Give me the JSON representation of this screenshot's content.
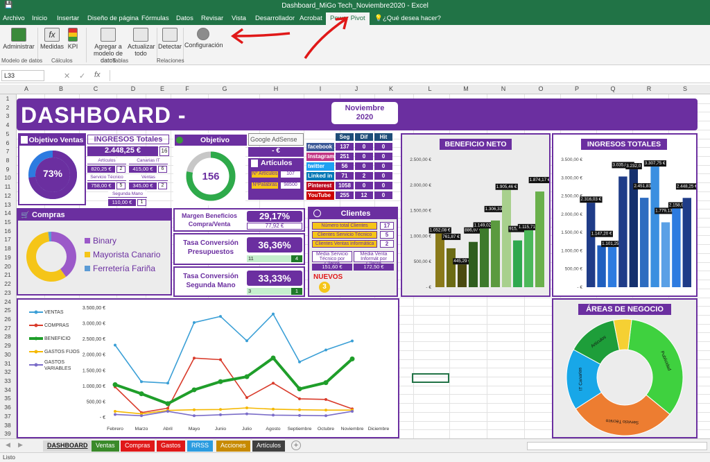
{
  "window": {
    "title": "Dashboard_MiGo Tech_Noviembre2020 - Excel"
  },
  "ribbon_tabs": [
    "Archivo",
    "Inicio",
    "Insertar",
    "Diseño de página",
    "Fórmulas",
    "Datos",
    "Revisar",
    "Vista",
    "Desarrollador",
    "Acrobat",
    "Power Pivot"
  ],
  "tellme": "¿Qué desea hacer?",
  "ribbon": {
    "buttons": [
      {
        "label": "Administrar"
      },
      {
        "label": "Medidas"
      },
      {
        "label": "KPI"
      },
      {
        "label": "Agregar a modelo de datos"
      },
      {
        "label": "Actualizar todo"
      },
      {
        "label": "Detectar"
      },
      {
        "label": "Configuración"
      }
    ],
    "groups": [
      "Modelo de datos",
      "Cálculos",
      "Tablas",
      "Relaciones"
    ]
  },
  "formula_bar": {
    "cell": "L33",
    "fx": "fx",
    "value": ""
  },
  "columns": [
    "A",
    "B",
    "C",
    "D",
    "E",
    "F",
    "G",
    "H",
    "I",
    "J",
    "K",
    "L",
    "M",
    "N",
    "O",
    "P",
    "Q",
    "R",
    "S"
  ],
  "rows": [
    "1",
    "2",
    "3",
    "4",
    "5",
    "6",
    "7",
    "8",
    "9",
    "10",
    "11",
    "12",
    "13",
    "14",
    "15",
    "16",
    "17",
    "18",
    "19",
    "20",
    "21",
    "22",
    "23",
    "24",
    "25",
    "26",
    "27",
    "28",
    "29",
    "30",
    "31",
    "32",
    "33",
    "34",
    "35",
    "36",
    "37",
    "38",
    "39"
  ],
  "dashboard": {
    "title": "DASHBOARD -",
    "period": "Noviembre 2020",
    "objetivo_ventas": {
      "title": "Objetivo Ventas",
      "pct": "73%",
      "pct_value": 0.73
    },
    "ingresos": {
      "title": "INGRESOS Totales",
      "total": "2.448,25 €",
      "count": "16",
      "items": [
        {
          "label": "Artículos",
          "value": "820,25 €",
          "n": "2"
        },
        {
          "label": "Canarias IT",
          "value": "415,00 €",
          "n": "6"
        },
        {
          "label": "Servicio Técnico",
          "value": "758,00 €",
          "n": "5"
        },
        {
          "label": "Ventas",
          "value": "345,00 €",
          "n": "2"
        },
        {
          "label": "Segunda Mano",
          "value": "110,00 €",
          "n": "1"
        }
      ]
    },
    "objetivo_beneficio": {
      "title": "Objetivo Beneficio",
      "value": "156",
      "fraction": 0.78
    },
    "adsense": {
      "label": "Google AdSense",
      "value": "-   €"
    },
    "articulos": {
      "title": "Artículos",
      "n_label": "Nº Artículos",
      "n_value": "107",
      "p_label": "NºPalabras",
      "p_value": "98500"
    },
    "social": {
      "headers": [
        "Seg",
        "Dif",
        "Hit"
      ],
      "rows": [
        {
          "net": "facebook",
          "color": "#3b5998",
          "v": [
            "137",
            "0",
            "0"
          ]
        },
        {
          "net": "Instagram",
          "color": "#c13584",
          "v": [
            "251",
            "0",
            "0"
          ]
        },
        {
          "net": "twitter",
          "color": "#1da1f2",
          "v": [
            "56",
            "0",
            "0"
          ]
        },
        {
          "net": "Linked in",
          "color": "#0077b5",
          "v": [
            "71",
            "2",
            "0"
          ]
        },
        {
          "net": "Pinterest",
          "color": "#bd081c",
          "v": [
            "1058",
            "0",
            "0"
          ]
        },
        {
          "net": "YouTube",
          "color": "#cc0000",
          "v": [
            "255",
            "12",
            "0"
          ]
        }
      ]
    },
    "compras": {
      "title": "Compras",
      "legend": [
        {
          "name": "Binary",
          "color": "#9b59c9"
        },
        {
          "name": "Mayorista Canario",
          "color": "#f5c518"
        },
        {
          "name": "Ferretería Fariña",
          "color": "#5b9bd5"
        }
      ],
      "fractions": [
        0.4,
        0.58,
        0.02
      ]
    },
    "margen": {
      "label": "Margen Beneficios Compra/Venta",
      "pct": "29,17%",
      "value": "77,92 €"
    },
    "conv_presup": {
      "label": "Tasa Conversión Presupuestos",
      "pct": "36,36%",
      "a": "11",
      "b": "4"
    },
    "conv_segunda": {
      "label": "Tasa Conversión Segunda Mano",
      "pct": "33,33%",
      "a": "3",
      "b": "1"
    },
    "clientes": {
      "title": "Clientes",
      "rows": [
        {
          "label": "Número total Clientes",
          "v": "17"
        },
        {
          "label": "Clientes Servicio Técnico",
          "v": "5"
        },
        {
          "label": "Clientes Ventas informática",
          "v": "2"
        }
      ],
      "media_st_label": "Media Servicio Técnico por Cliente",
      "media_st": "151,60 €",
      "media_vi_label": "Media Venta Informát por Cliente",
      "media_vi": "172,50 €",
      "nuevos_label": "NUEVOS",
      "nuevos": "3"
    }
  },
  "chart_data": [
    {
      "type": "bar",
      "title": "BENEFICIO NETO",
      "ylim": [
        0,
        2500
      ],
      "yticks": [
        "2.500,00 €",
        "2.000,00 €",
        "1.500,00 €",
        "1.000,00 €",
        "500,00 €",
        "-   €"
      ],
      "values": [
        1052.08,
        761.87,
        445.29,
        886.97,
        1149.02,
        1306.33,
        1905.46,
        915.75,
        1115.71,
        1874.17
      ],
      "labels": [
        "1.052,08 €",
        "761,87 €",
        "445,29 €",
        "886,97 €",
        "1.149,02 €",
        "1.306,33 €",
        "1.905,46 €",
        "915,75 €",
        "1.115,71 €",
        "1.874,17 €"
      ],
      "colors": [
        "#8a7a1a",
        "#6b6b14",
        "#4a4a10",
        "#2f5e1f",
        "#3d7a2b",
        "#5b9a3f",
        "#a8d08d",
        "#2fa84f",
        "#4cb85a",
        "#6ab04c"
      ]
    },
    {
      "type": "bar",
      "title": "INGRESOS TOTALES",
      "ylim": [
        0,
        3500
      ],
      "yticks": [
        "3.500,00 €",
        "3.000,00 €",
        "2.500,00 €",
        "2.000,00 €",
        "1.500,00 €",
        "1.000,00 €",
        "500,00 €",
        "-   €"
      ],
      "values": [
        2316.03,
        1147.2,
        1101.25,
        3035,
        3232,
        2451.83,
        3307.75,
        1779.13,
        2158.9,
        2448.25
      ],
      "labels": [
        "2.316,03 €",
        "1.147,20 €",
        "1.101,25 €",
        "3.035,00 €",
        "3.232,0",
        "2.451,83 €",
        "3.307,75 €",
        "1.779,13 €",
        "2.158,9",
        "2.448,25 €"
      ],
      "colors": [
        "#1f3c88",
        "#1f5fbf",
        "#2d7be0",
        "#1f3c88",
        "#15306e",
        "#2d6cc0",
        "#3b8fe0",
        "#5aa0e6",
        "#2d7be0",
        "#1f3c88"
      ]
    },
    {
      "type": "pie",
      "title": "ÁREAS DE NEGOCIO",
      "labels": [
        "Publicidad",
        "Servicio Técnico",
        "IT Canarias",
        "Artículos",
        ""
      ],
      "values": [
        34,
        30,
        17,
        14,
        5
      ],
      "colors": [
        "#3fd13f",
        "#ed7d31",
        "#18a7e8",
        "#1e9e3a",
        "#f5d033"
      ]
    },
    {
      "type": "line",
      "categories": [
        "Febrero",
        "Marzo",
        "Abril",
        "Mayo",
        "Junio",
        "Julio",
        "Agosto",
        "Septiembre",
        "Octubre",
        "Noviembre",
        "Diciembre"
      ],
      "yticks": [
        "3.500,00 €",
        "3.000,00 €",
        "2.500,00 €",
        "2.000,00 €",
        "1.500,00 €",
        "1.000,00 €",
        "500,00 €",
        "-   €"
      ],
      "ylim": [
        0,
        3500
      ],
      "series": [
        {
          "name": "VENTAS",
          "color": "#3a9fd6",
          "values": [
            2316,
            1147,
            1101,
            3035,
            3232,
            2452,
            3308,
            1779,
            2159,
            2448
          ]
        },
        {
          "name": "COMPRAS",
          "color": "#d93b2b",
          "values": [
            980,
            160,
            300,
            1900,
            1850,
            640,
            1100,
            600,
            580,
            280
          ]
        },
        {
          "name": "BENEFICIO",
          "color": "#1f9e2a",
          "values": [
            1052,
            762,
            445,
            887,
            1149,
            1306,
            1905,
            916,
            1116,
            1874
          ]
        },
        {
          "name": "GASTOS FIJOS",
          "color": "#f5b800",
          "values": [
            200,
            120,
            230,
            250,
            260,
            310,
            270,
            250,
            240,
            240
          ]
        },
        {
          "name": "GASTOS VARIABLES",
          "color": "#7a6cc8",
          "values": [
            100,
            60,
            200,
            60,
            90,
            120,
            80,
            70,
            60,
            200
          ]
        }
      ]
    }
  ],
  "sheet_tabs": [
    {
      "label": "DASHBOARD",
      "color": "#d9d9d9",
      "text": "#1a1a1a"
    },
    {
      "label": "Ventas",
      "color": "#3a8a2a",
      "text": "#ffffff"
    },
    {
      "label": "Compras",
      "color": "#e01818",
      "text": "#ffffff"
    },
    {
      "label": "Gastos",
      "color": "#e01818",
      "text": "#ffffff"
    },
    {
      "label": "RRSS",
      "color": "#2b9ce0",
      "text": "#ffffff"
    },
    {
      "label": "Acciones",
      "color": "#c78a00",
      "text": "#ffffff"
    },
    {
      "label": "Artículos",
      "color": "#404040",
      "text": "#ffffff"
    }
  ],
  "status": "Listo"
}
